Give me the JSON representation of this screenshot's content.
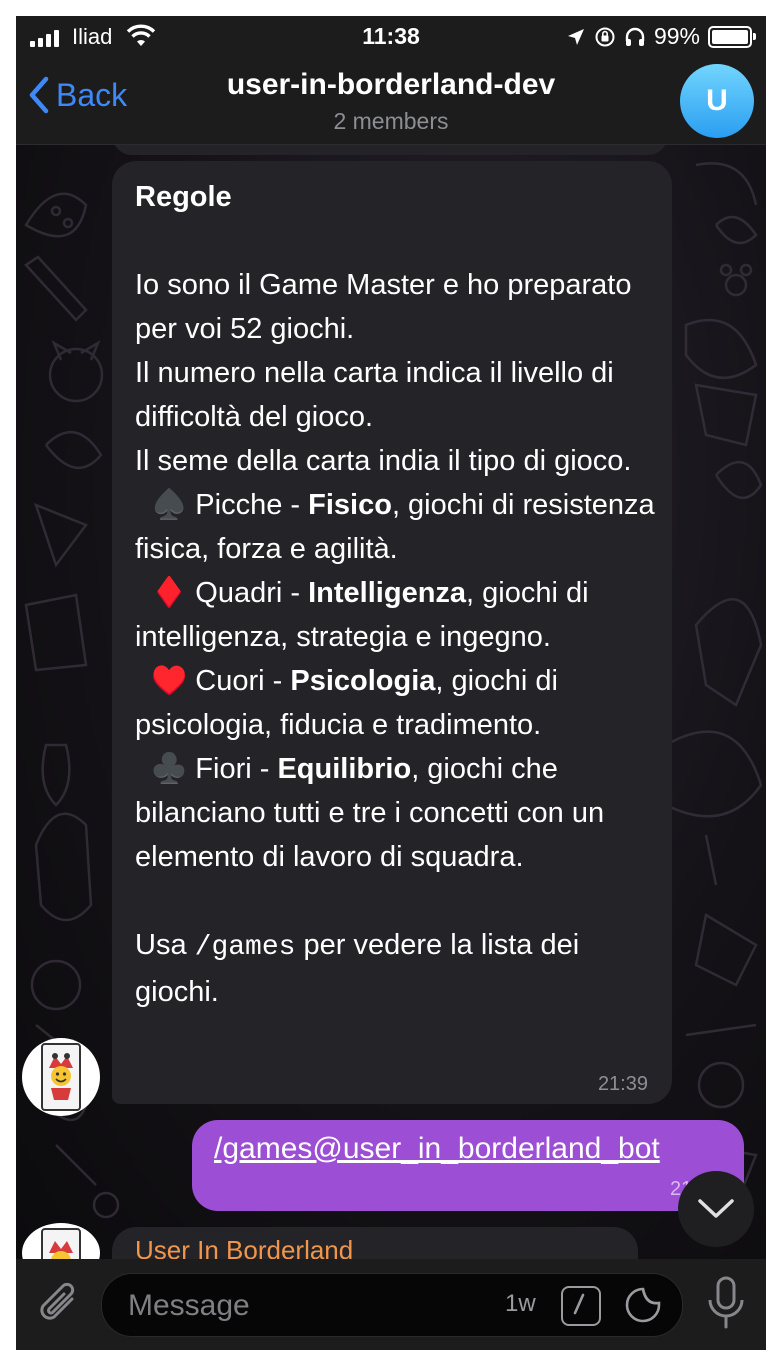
{
  "status_bar": {
    "carrier": "Iliad",
    "time": "11:38",
    "battery": "99%",
    "battery_level": 0.99
  },
  "nav": {
    "back_label": "Back",
    "title": "user-in-borderland-dev",
    "subtitle": "2 members",
    "avatar_letter": "U",
    "avatar_color": "#3ba6f5"
  },
  "messages": [
    {
      "title": "Regole",
      "p1": "Io sono il Game Master e ho preparato per voi 52 giochi.\nIl numero nella carta indica il livello di difficoltà del gioco.\nIl seme della carta india il tipo di gioco.",
      "suits": [
        {
          "icon": "spade-icon",
          "glyph": "♠️",
          "name": "Picche - ",
          "bold": "Fisico",
          "rest": ", giochi di resistenza fisica, forza e agilità."
        },
        {
          "icon": "diamond-icon",
          "glyph": "♦️",
          "name": "Quadri - ",
          "bold": "Intelligenza",
          "rest": ", giochi di intelligenza, strategia e ingegno."
        },
        {
          "icon": "heart-icon",
          "glyph": "♥️",
          "name": "Cuori - ",
          "bold": "Psicologia",
          "rest": ", giochi di psicologia, fiducia e tradimento."
        },
        {
          "icon": "club-icon",
          "glyph": "♣️",
          "name": "Fiori - ",
          "bold": "Equilibrio",
          "rest": ", giochi che bilanciano tutti e tre i concetti con un elemento di lavoro di squadra."
        }
      ],
      "footer_pre": "Usa ",
      "footer_cmd": "/games",
      "footer_post": " per vedere la lista dei giochi.",
      "time": "21:39"
    },
    {
      "text": "/games@user_in_borderland_bot",
      "time": "21:42"
    },
    {
      "sender": "User In Borderland",
      "sender_color": "#f0964a"
    }
  ],
  "input": {
    "placeholder": "Message",
    "timer": "1w"
  },
  "colors": {
    "accent": "#3e88f7",
    "outgoing_bubble": "#9c4ed4",
    "incoming_bubble": "#242328"
  }
}
